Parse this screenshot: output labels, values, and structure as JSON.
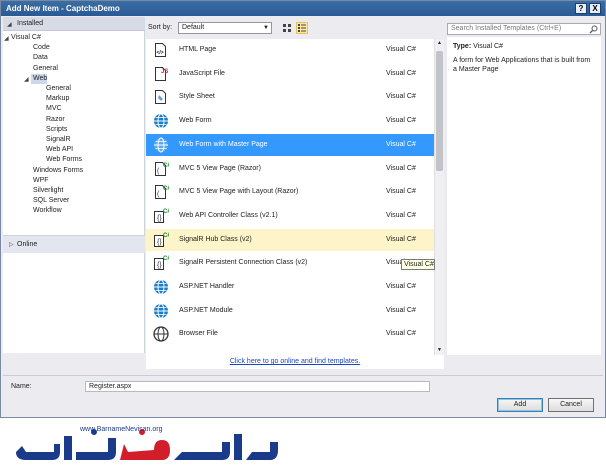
{
  "window": {
    "title": "Add New Item - CaptchaDemo",
    "help_button": "?",
    "close_button": "X"
  },
  "left_pane": {
    "installed_label": "Installed",
    "tree": [
      {
        "label": "Visual C#",
        "level": 1,
        "expanded": true
      },
      {
        "label": "Code",
        "level": 2
      },
      {
        "label": "Data",
        "level": 2
      },
      {
        "label": "General",
        "level": 2
      },
      {
        "label": "Web",
        "level": 2,
        "expanded": true,
        "selected": true
      },
      {
        "label": "General",
        "level": 3
      },
      {
        "label": "Markup",
        "level": 3
      },
      {
        "label": "MVC",
        "level": 3
      },
      {
        "label": "Razor",
        "level": 3
      },
      {
        "label": "Scripts",
        "level": 3
      },
      {
        "label": "SignalR",
        "level": 3
      },
      {
        "label": "Web API",
        "level": 3
      },
      {
        "label": "Web Forms",
        "level": 3
      },
      {
        "label": "Windows Forms",
        "level": 2
      },
      {
        "label": "WPF",
        "level": 2
      },
      {
        "label": "Silverlight",
        "level": 2
      },
      {
        "label": "SQL Server",
        "level": 2
      },
      {
        "label": "Workflow",
        "level": 2
      }
    ],
    "online_label": "Online"
  },
  "toolbar": {
    "sort_label": "Sort by:",
    "sort_value": "Default"
  },
  "templates": [
    {
      "name": "HTML Page",
      "lang": "Visual C#",
      "icon": "html-page-icon"
    },
    {
      "name": "JavaScript File",
      "lang": "Visual C#",
      "icon": "javascript-file-icon"
    },
    {
      "name": "Style Sheet",
      "lang": "Visual C#",
      "icon": "style-sheet-icon"
    },
    {
      "name": "Web Form",
      "lang": "Visual C#",
      "icon": "globe-icon"
    },
    {
      "name": "Web Form with Master Page",
      "lang": "Visual C#",
      "icon": "globe-icon",
      "selected": true
    },
    {
      "name": "MVC 5 View Page (Razor)",
      "lang": "Visual C#",
      "icon": "mvc-page-icon"
    },
    {
      "name": "MVC 5 View Page with Layout (Razor)",
      "lang": "Visual C#",
      "icon": "mvc-page-icon"
    },
    {
      "name": "Web API Controller Class (v2.1)",
      "lang": "Visual C#",
      "icon": "class-icon"
    },
    {
      "name": "SignalR Hub Class (v2)",
      "lang": "Visual C#",
      "icon": "class-icon",
      "hovered": true
    },
    {
      "name": "SignalR Persistent Connection Class (v2)",
      "lang": "Visual C#",
      "icon": "class-icon"
    },
    {
      "name": "ASP.NET Handler",
      "lang": "Visual C#",
      "icon": "globe-icon"
    },
    {
      "name": "ASP.NET Module",
      "lang": "Visual C#",
      "icon": "globe-icon"
    },
    {
      "name": "Browser File",
      "lang": "Visual C#",
      "icon": "browser-file-icon"
    }
  ],
  "online_link": "Click here to go online and find templates.",
  "tooltip": "Visual C#",
  "search": {
    "placeholder": "Search Installed Templates (Ctrl+E)"
  },
  "info": {
    "type_label": "Type:",
    "type_value": "Visual C#",
    "description": "A form for Web Applications that is built from a Master Page"
  },
  "name_field": {
    "label": "Name:",
    "value": "Register.aspx"
  },
  "buttons": {
    "add": "Add",
    "cancel": "Cancel"
  },
  "banner": {
    "url": "www.BarnameNevisan.org",
    "brand_color": "#1a3a8a",
    "accent_color": "#d11e2a"
  },
  "colors": {
    "selection": "#3399ff",
    "hover": "#fdf4c9",
    "titlebar": "#2f64a0"
  }
}
